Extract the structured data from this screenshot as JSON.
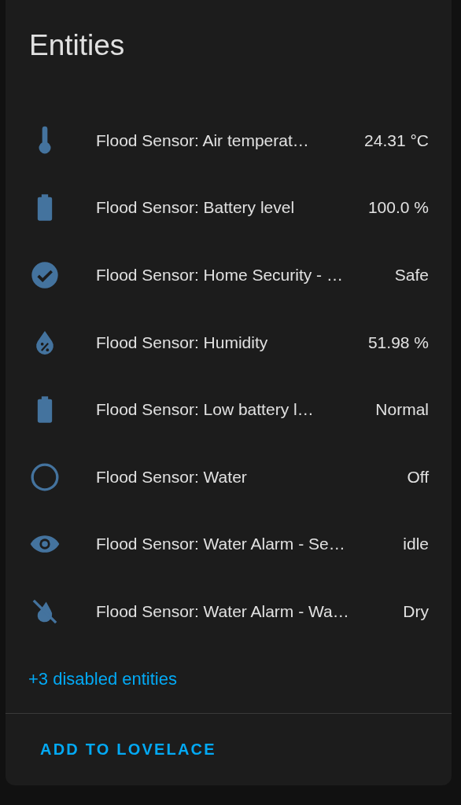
{
  "card": {
    "title": "Entities",
    "entities": [
      {
        "kind": "thermometer",
        "name": "Flood Sensor: Air temperat…",
        "state": "24.31 °C"
      },
      {
        "kind": "battery",
        "name": "Flood Sensor: Battery level",
        "state": "100.0 %"
      },
      {
        "kind": "check-circle",
        "name": "Flood Sensor: Home Security - …",
        "state": "Safe"
      },
      {
        "kind": "water-percent",
        "name": "Flood Sensor: Humidity",
        "state": "51.98 %"
      },
      {
        "kind": "battery",
        "name": "Flood Sensor: Low battery l…",
        "state": "Normal"
      },
      {
        "kind": "circle-outline",
        "name": "Flood Sensor: Water",
        "state": "Off"
      },
      {
        "kind": "eye",
        "name": "Flood Sensor: Water Alarm - Se…",
        "state": "idle"
      },
      {
        "kind": "water-off",
        "name": "Flood Sensor: Water Alarm - Wa…",
        "state": "Dry"
      }
    ],
    "disabled_link": "+3 disabled entities",
    "action_button": "ADD TO LOVELACE"
  }
}
